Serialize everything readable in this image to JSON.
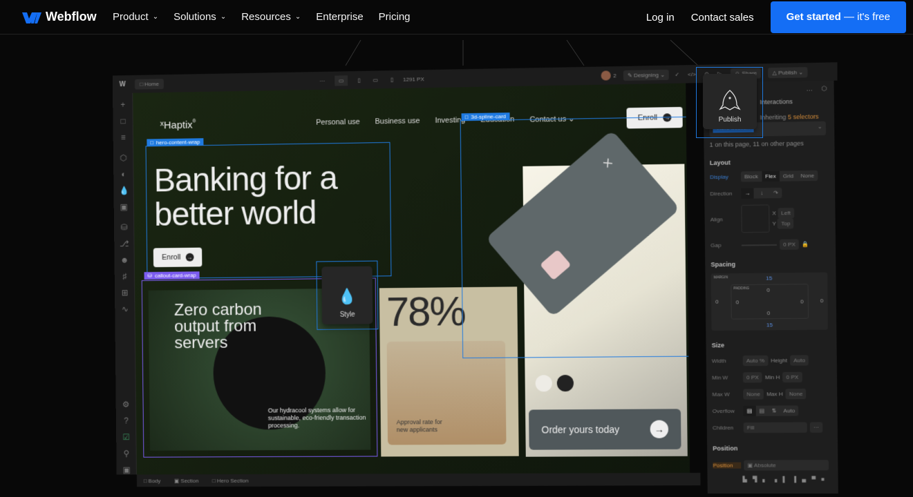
{
  "topnav": {
    "brand": "Webflow",
    "brand_color": "#146ef5",
    "links": [
      {
        "label": "Product",
        "has_dropdown": true
      },
      {
        "label": "Solutions",
        "has_dropdown": true
      },
      {
        "label": "Resources",
        "has_dropdown": true
      },
      {
        "label": "Enterprise",
        "has_dropdown": false
      },
      {
        "label": "Pricing",
        "has_dropdown": false
      }
    ],
    "login": "Log in",
    "contact": "Contact sales",
    "cta_bold": "Get started",
    "cta_rest": " — it's free"
  },
  "editor": {
    "page_tab": "Home",
    "breakpoint_width": "1291 PX",
    "collaborators_count": "2",
    "mode": "Designing",
    "share": "Share",
    "publish": "Publish",
    "left_icons": [
      "plus-icon",
      "page-icon",
      "navigator-icon",
      "components-icon",
      "variables-icon",
      "style-drops-icon",
      "assets-icon",
      "cms-icon",
      "logic-icon",
      "users-icon",
      "ecommerce-icon",
      "apps-icon",
      "audit-icon",
      "settings-icon",
      "help-icon",
      "checklist-icon",
      "search-icon",
      "video-icon"
    ],
    "breadcrumbs": [
      "Body",
      "Section",
      "Hero Section"
    ]
  },
  "site": {
    "logo": "Haptix",
    "nav": [
      "Personal use",
      "Business use",
      "Investing",
      "Education",
      "Contact us"
    ],
    "enroll": "Enroll",
    "hero_title_1": "Banking for a",
    "hero_title_2": "better world",
    "hero_enroll": "Enroll",
    "green_card": {
      "title_1": "Zero carbon",
      "title_2": "output from",
      "title_3": "servers",
      "body": "Our hydracool systems allow for sustainable, eco-friendly transaction processing."
    },
    "stat_card": {
      "value": "78%",
      "label_1": "Approval rate for",
      "label_2": "new applicants"
    },
    "order_button": "Order yours today",
    "swatches": [
      "#eeece6",
      "#222222"
    ]
  },
  "selection_tags": {
    "hero": "hero-content-wrap",
    "callout": "callout-card-wrap",
    "spline": "3d-spline-card"
  },
  "tooltips": {
    "publish": "Publish",
    "style": "Style"
  },
  "panel": {
    "tab_interactions": "Interactions",
    "inheriting": "Inheriting",
    "selectors": "5 selectors",
    "selector_name": "Hero Section",
    "usage": "1 on this page, 11 on other pages",
    "layout": {
      "title": "Layout",
      "display_label": "Display",
      "display_options": [
        "Block",
        "Flex",
        "Grid",
        "None"
      ],
      "display_selected": "Flex",
      "direction_label": "Direction",
      "align_label": "Align",
      "x_label": "X",
      "x_value": "Left",
      "y_label": "Y",
      "y_value": "Top",
      "gap_label": "Gap",
      "gap_value": "0",
      "gap_unit": "PX"
    },
    "spacing": {
      "title": "Spacing",
      "margin_label": "MARGIN",
      "padding_label": "PADDING",
      "margin": {
        "top": "15",
        "right": "0",
        "bottom": "15",
        "left": "0"
      },
      "padding": {
        "top": "0",
        "right": "0",
        "bottom": "0",
        "left": "0"
      }
    },
    "size": {
      "title": "Size",
      "width_label": "Width",
      "width": "Auto",
      "width_unit": "%",
      "height_label": "Height",
      "height": "Auto",
      "min_w_label": "Min W",
      "min_w": "0",
      "min_w_unit": "PX",
      "min_h_label": "Min H",
      "min_h": "0",
      "min_h_unit": "PX",
      "max_w_label": "Max W",
      "max_w": "None",
      "max_h_label": "Max H",
      "max_h": "None",
      "overflow_label": "Overflow",
      "overflow_auto": "Auto",
      "children_label": "Children",
      "children": "Fill"
    },
    "position": {
      "title": "Position",
      "label": "Position",
      "value": "Absolute"
    },
    "accent_orange": "#d08a3a"
  }
}
